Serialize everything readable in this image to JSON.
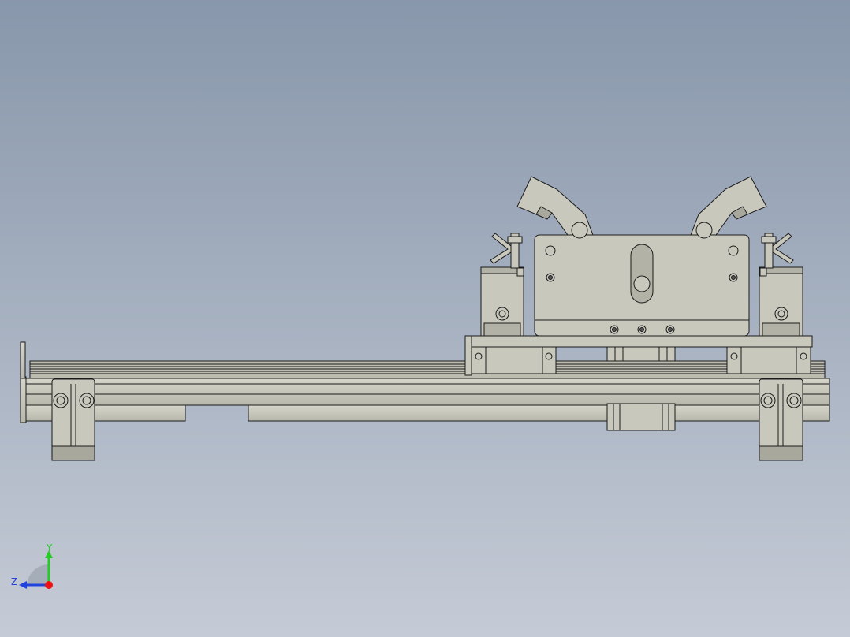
{
  "viewport": {
    "background_top": "#8897ab",
    "background_bottom": "#c5cbd6",
    "part_fill": "#c9c8bd",
    "part_shade": "#a9a89d",
    "edge_color": "#1a1a1a"
  },
  "triad": {
    "y_label": "Y",
    "z_label": "Z",
    "y_color": "#22cc22",
    "z_color": "#2244dd",
    "x_color": "#ee1111"
  }
}
